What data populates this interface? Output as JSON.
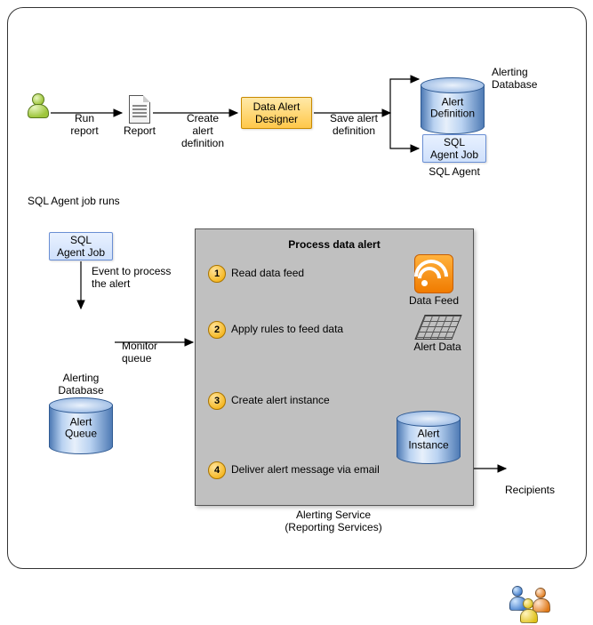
{
  "top": {
    "run_report": "Run\nreport",
    "report": "Report",
    "create_def": "Create\nalert\ndefinition",
    "designer": "Data Alert\nDesigner",
    "save_def": "Save alert\ndefinition",
    "alert_def": "Alert\nDefinition",
    "alerting_db": "Alerting\nDatabase",
    "sql_job": "SQL\nAgent Job",
    "sql_agent": "SQL Agent"
  },
  "mid": {
    "heading": "SQL Agent job runs",
    "sql_job": "SQL\nAgent Job",
    "event": "Event to process\nthe alert",
    "queue": "Alert\nQueue",
    "alerting_db": "Alerting\nDatabase",
    "monitor": "Monitor\nqueue"
  },
  "proc": {
    "title": "Process data alert",
    "steps": {
      "s1": {
        "n": "1",
        "t": "Read data feed"
      },
      "s2": {
        "n": "2",
        "t": "Apply rules to feed data"
      },
      "s3": {
        "n": "3",
        "t": "Create alert instance"
      },
      "s4": {
        "n": "4",
        "t": "Deliver alert message via email"
      }
    },
    "data_feed": "Data Feed",
    "alert_data": "Alert Data",
    "alert_instance": "Alert\nInstance",
    "caption": "Alerting Service\n(Reporting Services)"
  },
  "recipients": "Recipients"
}
